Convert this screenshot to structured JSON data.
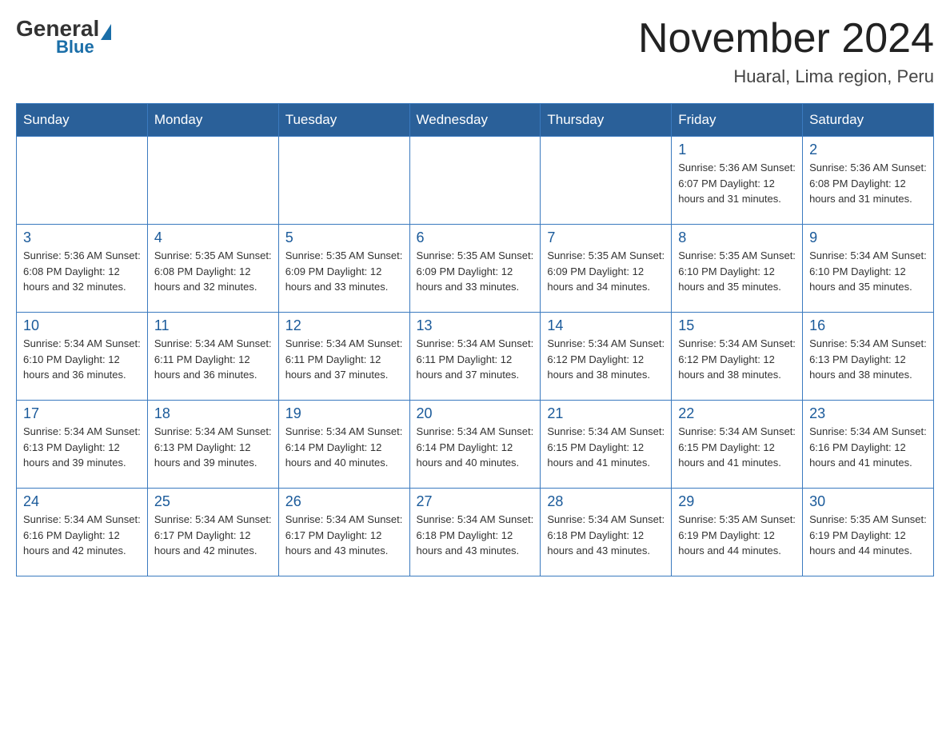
{
  "header": {
    "logo": {
      "general": "General",
      "blue": "Blue"
    },
    "title": "November 2024",
    "location": "Huaral, Lima region, Peru"
  },
  "calendar": {
    "days_of_week": [
      "Sunday",
      "Monday",
      "Tuesday",
      "Wednesday",
      "Thursday",
      "Friday",
      "Saturday"
    ],
    "weeks": [
      [
        {
          "day": "",
          "info": ""
        },
        {
          "day": "",
          "info": ""
        },
        {
          "day": "",
          "info": ""
        },
        {
          "day": "",
          "info": ""
        },
        {
          "day": "",
          "info": ""
        },
        {
          "day": "1",
          "info": "Sunrise: 5:36 AM\nSunset: 6:07 PM\nDaylight: 12 hours and 31 minutes."
        },
        {
          "day": "2",
          "info": "Sunrise: 5:36 AM\nSunset: 6:08 PM\nDaylight: 12 hours and 31 minutes."
        }
      ],
      [
        {
          "day": "3",
          "info": "Sunrise: 5:36 AM\nSunset: 6:08 PM\nDaylight: 12 hours and 32 minutes."
        },
        {
          "day": "4",
          "info": "Sunrise: 5:35 AM\nSunset: 6:08 PM\nDaylight: 12 hours and 32 minutes."
        },
        {
          "day": "5",
          "info": "Sunrise: 5:35 AM\nSunset: 6:09 PM\nDaylight: 12 hours and 33 minutes."
        },
        {
          "day": "6",
          "info": "Sunrise: 5:35 AM\nSunset: 6:09 PM\nDaylight: 12 hours and 33 minutes."
        },
        {
          "day": "7",
          "info": "Sunrise: 5:35 AM\nSunset: 6:09 PM\nDaylight: 12 hours and 34 minutes."
        },
        {
          "day": "8",
          "info": "Sunrise: 5:35 AM\nSunset: 6:10 PM\nDaylight: 12 hours and 35 minutes."
        },
        {
          "day": "9",
          "info": "Sunrise: 5:34 AM\nSunset: 6:10 PM\nDaylight: 12 hours and 35 minutes."
        }
      ],
      [
        {
          "day": "10",
          "info": "Sunrise: 5:34 AM\nSunset: 6:10 PM\nDaylight: 12 hours and 36 minutes."
        },
        {
          "day": "11",
          "info": "Sunrise: 5:34 AM\nSunset: 6:11 PM\nDaylight: 12 hours and 36 minutes."
        },
        {
          "day": "12",
          "info": "Sunrise: 5:34 AM\nSunset: 6:11 PM\nDaylight: 12 hours and 37 minutes."
        },
        {
          "day": "13",
          "info": "Sunrise: 5:34 AM\nSunset: 6:11 PM\nDaylight: 12 hours and 37 minutes."
        },
        {
          "day": "14",
          "info": "Sunrise: 5:34 AM\nSunset: 6:12 PM\nDaylight: 12 hours and 38 minutes."
        },
        {
          "day": "15",
          "info": "Sunrise: 5:34 AM\nSunset: 6:12 PM\nDaylight: 12 hours and 38 minutes."
        },
        {
          "day": "16",
          "info": "Sunrise: 5:34 AM\nSunset: 6:13 PM\nDaylight: 12 hours and 38 minutes."
        }
      ],
      [
        {
          "day": "17",
          "info": "Sunrise: 5:34 AM\nSunset: 6:13 PM\nDaylight: 12 hours and 39 minutes."
        },
        {
          "day": "18",
          "info": "Sunrise: 5:34 AM\nSunset: 6:13 PM\nDaylight: 12 hours and 39 minutes."
        },
        {
          "day": "19",
          "info": "Sunrise: 5:34 AM\nSunset: 6:14 PM\nDaylight: 12 hours and 40 minutes."
        },
        {
          "day": "20",
          "info": "Sunrise: 5:34 AM\nSunset: 6:14 PM\nDaylight: 12 hours and 40 minutes."
        },
        {
          "day": "21",
          "info": "Sunrise: 5:34 AM\nSunset: 6:15 PM\nDaylight: 12 hours and 41 minutes."
        },
        {
          "day": "22",
          "info": "Sunrise: 5:34 AM\nSunset: 6:15 PM\nDaylight: 12 hours and 41 minutes."
        },
        {
          "day": "23",
          "info": "Sunrise: 5:34 AM\nSunset: 6:16 PM\nDaylight: 12 hours and 41 minutes."
        }
      ],
      [
        {
          "day": "24",
          "info": "Sunrise: 5:34 AM\nSunset: 6:16 PM\nDaylight: 12 hours and 42 minutes."
        },
        {
          "day": "25",
          "info": "Sunrise: 5:34 AM\nSunset: 6:17 PM\nDaylight: 12 hours and 42 minutes."
        },
        {
          "day": "26",
          "info": "Sunrise: 5:34 AM\nSunset: 6:17 PM\nDaylight: 12 hours and 43 minutes."
        },
        {
          "day": "27",
          "info": "Sunrise: 5:34 AM\nSunset: 6:18 PM\nDaylight: 12 hours and 43 minutes."
        },
        {
          "day": "28",
          "info": "Sunrise: 5:34 AM\nSunset: 6:18 PM\nDaylight: 12 hours and 43 minutes."
        },
        {
          "day": "29",
          "info": "Sunrise: 5:35 AM\nSunset: 6:19 PM\nDaylight: 12 hours and 44 minutes."
        },
        {
          "day": "30",
          "info": "Sunrise: 5:35 AM\nSunset: 6:19 PM\nDaylight: 12 hours and 44 minutes."
        }
      ]
    ]
  }
}
